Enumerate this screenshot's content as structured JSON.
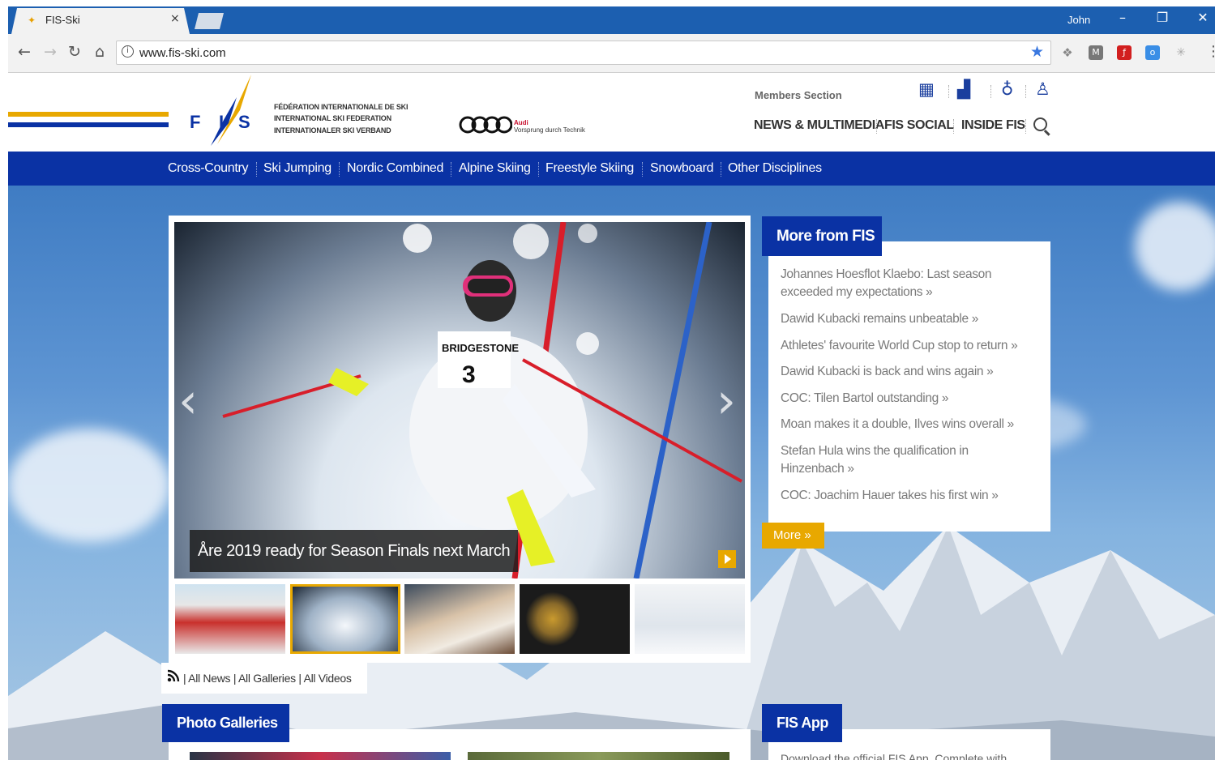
{
  "browser": {
    "tab_title": "FIS-Ski",
    "tab_close": "×",
    "profile_name": "John",
    "url": "www.fis-ski.com",
    "window_controls": {
      "minimize": "–",
      "restore": "❐",
      "close": "✕"
    },
    "nav": {
      "back": "←",
      "forward": "→",
      "reload": "↻",
      "home": "⌂"
    },
    "icons": [
      "back-icon",
      "forward-icon",
      "reload-icon",
      "home-icon",
      "info-icon",
      "star-icon",
      "dropbox-icon",
      "extension-icon",
      "flash-icon",
      "outlook-icon",
      "settings-icon",
      "menu-icon"
    ],
    "accent": "#1c5fb0"
  },
  "header": {
    "federation_lines": [
      "FÉDÉRATION INTERNATIONALE DE SKI",
      "INTERNATIONAL SKI FEDERATION",
      "INTERNATIONALER SKI VERBAND"
    ],
    "logo_letters": "FIS",
    "sponsor": {
      "brand": "Audi",
      "slogan": "Vorsprung durch Technik"
    },
    "members_label": "Members Section",
    "icons": [
      "calendar-icon",
      "results-chart-icon",
      "medal-icon",
      "athlete-icon"
    ],
    "top_nav": [
      "NEWS & MULTIMEDIA",
      "FIS SOCIAL",
      "INSIDE FIS"
    ],
    "stripe_colors": [
      "#e8a800",
      "#0a32a4"
    ]
  },
  "disciplines": [
    "Cross-Country",
    "Ski Jumping",
    "Nordic Combined",
    "Alpine Skiing",
    "Freestyle Skiing",
    "Snowboard",
    "Other Disciplines"
  ],
  "slider": {
    "caption": "Åre 2019 ready for Season Finals next March",
    "prev": "‹",
    "next": "›",
    "thumbnails": [
      "podium",
      "slalom",
      "meeting",
      "medals",
      "downhill"
    ],
    "active_thumbnail": 1,
    "links": {
      "all_news": "All News",
      "all_galleries": "All Galleries",
      "all_videos": "All Videos",
      "separator": "|"
    }
  },
  "more_from_fis": {
    "title": "More from FIS",
    "items": [
      "Johannes Hoesflot Klaebo: Last season exceeded my expectations »",
      "Dawid Kubacki remains unbeatable »",
      "Athletes' favourite World Cup stop to return »",
      "Dawid Kubacki is back and wins again »",
      "COC: Tilen Bartol outstanding »",
      "Moan makes it a double, Ilves wins overall »",
      "Stefan Hula wins the qualification in Hinzenbach »",
      "COC: Joachim Hauer takes his first win »"
    ],
    "more_label": "More »"
  },
  "photo_galleries": {
    "title": "Photo Galleries"
  },
  "fis_app": {
    "title": "FIS App",
    "text": "Download the official FIS App. Complete with"
  },
  "colors": {
    "brand_blue": "#0a32a4",
    "accent_yellow": "#e8a800"
  }
}
